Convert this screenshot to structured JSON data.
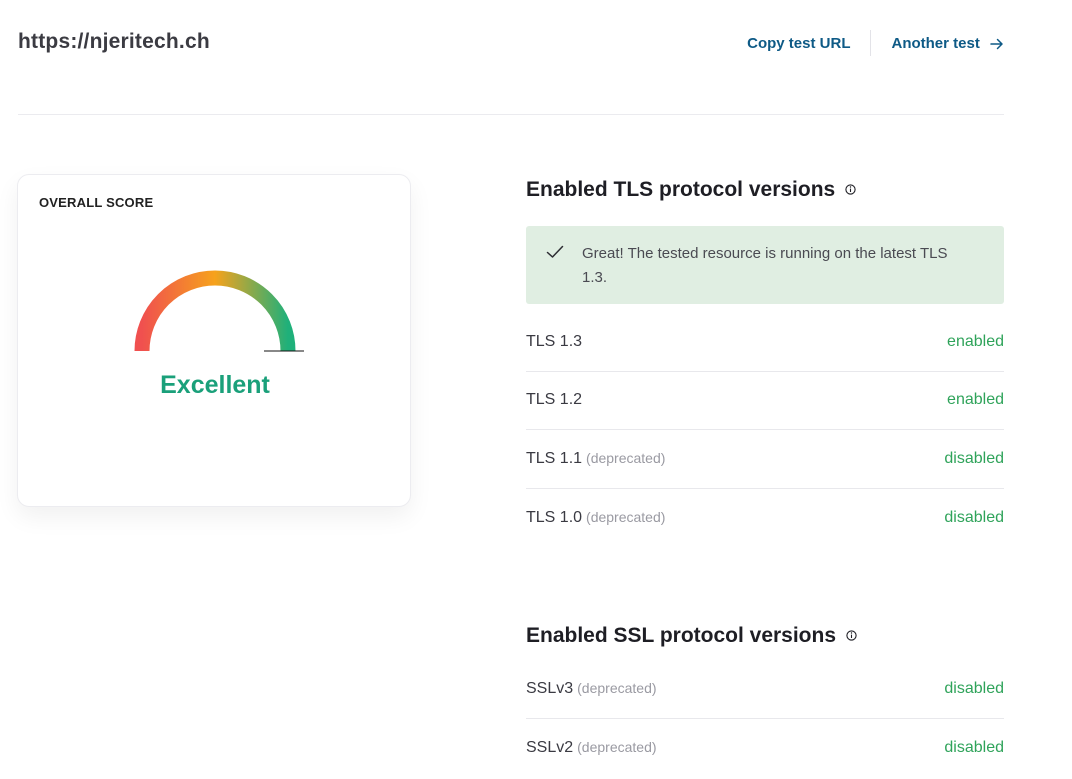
{
  "header": {
    "site_url": "https://njeritech.ch",
    "copy_link": "Copy test URL",
    "another_link": "Another test"
  },
  "score": {
    "label": "OVERALL SCORE",
    "value": "Excellent",
    "gauge_level": 1.0,
    "colors": {
      "start": "#f0504f",
      "mid": "#f6a21c",
      "end": "#1fb07a",
      "value": "#1aa07a"
    }
  },
  "tls": {
    "title": "Enabled TLS protocol versions",
    "notice": "Great! The tested resource is running on the latest TLS 1.3.",
    "rows": [
      {
        "name": "TLS 1.3",
        "note": "",
        "status": "enabled"
      },
      {
        "name": "TLS 1.2",
        "note": "",
        "status": "enabled"
      },
      {
        "name": "TLS 1.1",
        "note": "(deprecated)",
        "status": "disabled"
      },
      {
        "name": "TLS 1.0",
        "note": "(deprecated)",
        "status": "disabled"
      }
    ]
  },
  "ssl": {
    "title": "Enabled SSL protocol versions",
    "rows": [
      {
        "name": "SSLv3",
        "note": "(deprecated)",
        "status": "disabled"
      },
      {
        "name": "SSLv2",
        "note": "(deprecated)",
        "status": "disabled"
      }
    ]
  },
  "colors": {
    "link": "#0e5a86",
    "status": "#2fa35a",
    "notice_bg": "#e0eee2"
  },
  "icons": [
    "arrow-right-icon",
    "info-icon",
    "check-icon"
  ]
}
